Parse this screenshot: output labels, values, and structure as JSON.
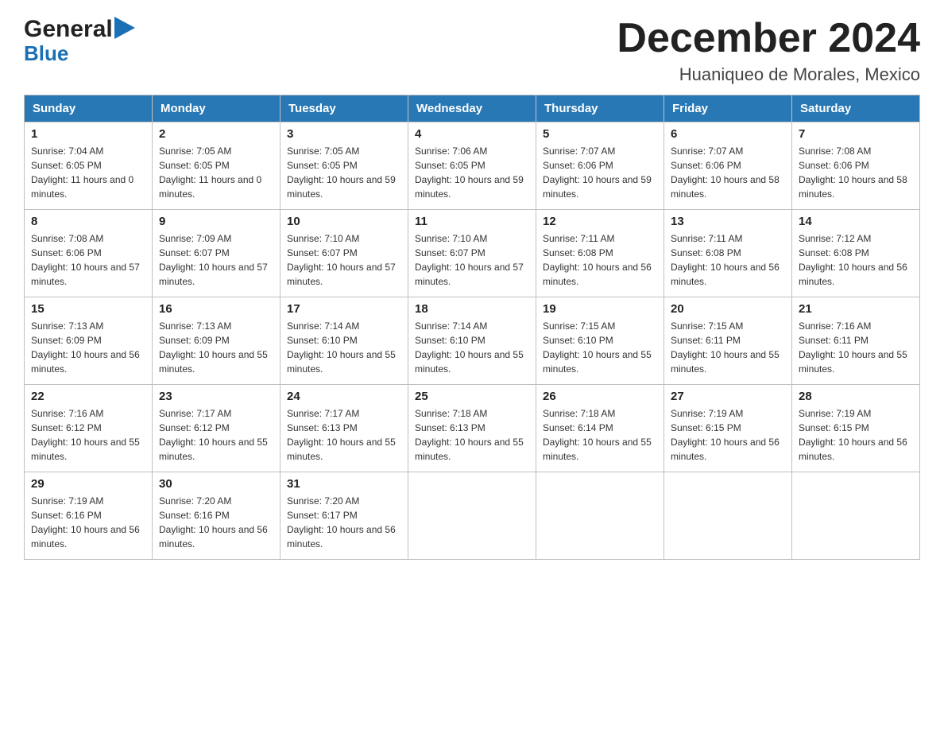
{
  "header": {
    "logo_line1": "General",
    "logo_line2": "Blue",
    "month_title": "December 2024",
    "location": "Huaniqueo de Morales, Mexico"
  },
  "days_of_week": [
    "Sunday",
    "Monday",
    "Tuesday",
    "Wednesday",
    "Thursday",
    "Friday",
    "Saturday"
  ],
  "weeks": [
    [
      {
        "day": "1",
        "sunrise": "7:04 AM",
        "sunset": "6:05 PM",
        "daylight": "11 hours and 0 minutes."
      },
      {
        "day": "2",
        "sunrise": "7:05 AM",
        "sunset": "6:05 PM",
        "daylight": "11 hours and 0 minutes."
      },
      {
        "day": "3",
        "sunrise": "7:05 AM",
        "sunset": "6:05 PM",
        "daylight": "10 hours and 59 minutes."
      },
      {
        "day": "4",
        "sunrise": "7:06 AM",
        "sunset": "6:05 PM",
        "daylight": "10 hours and 59 minutes."
      },
      {
        "day": "5",
        "sunrise": "7:07 AM",
        "sunset": "6:06 PM",
        "daylight": "10 hours and 59 minutes."
      },
      {
        "day": "6",
        "sunrise": "7:07 AM",
        "sunset": "6:06 PM",
        "daylight": "10 hours and 58 minutes."
      },
      {
        "day": "7",
        "sunrise": "7:08 AM",
        "sunset": "6:06 PM",
        "daylight": "10 hours and 58 minutes."
      }
    ],
    [
      {
        "day": "8",
        "sunrise": "7:08 AM",
        "sunset": "6:06 PM",
        "daylight": "10 hours and 57 minutes."
      },
      {
        "day": "9",
        "sunrise": "7:09 AM",
        "sunset": "6:07 PM",
        "daylight": "10 hours and 57 minutes."
      },
      {
        "day": "10",
        "sunrise": "7:10 AM",
        "sunset": "6:07 PM",
        "daylight": "10 hours and 57 minutes."
      },
      {
        "day": "11",
        "sunrise": "7:10 AM",
        "sunset": "6:07 PM",
        "daylight": "10 hours and 57 minutes."
      },
      {
        "day": "12",
        "sunrise": "7:11 AM",
        "sunset": "6:08 PM",
        "daylight": "10 hours and 56 minutes."
      },
      {
        "day": "13",
        "sunrise": "7:11 AM",
        "sunset": "6:08 PM",
        "daylight": "10 hours and 56 minutes."
      },
      {
        "day": "14",
        "sunrise": "7:12 AM",
        "sunset": "6:08 PM",
        "daylight": "10 hours and 56 minutes."
      }
    ],
    [
      {
        "day": "15",
        "sunrise": "7:13 AM",
        "sunset": "6:09 PM",
        "daylight": "10 hours and 56 minutes."
      },
      {
        "day": "16",
        "sunrise": "7:13 AM",
        "sunset": "6:09 PM",
        "daylight": "10 hours and 55 minutes."
      },
      {
        "day": "17",
        "sunrise": "7:14 AM",
        "sunset": "6:10 PM",
        "daylight": "10 hours and 55 minutes."
      },
      {
        "day": "18",
        "sunrise": "7:14 AM",
        "sunset": "6:10 PM",
        "daylight": "10 hours and 55 minutes."
      },
      {
        "day": "19",
        "sunrise": "7:15 AM",
        "sunset": "6:10 PM",
        "daylight": "10 hours and 55 minutes."
      },
      {
        "day": "20",
        "sunrise": "7:15 AM",
        "sunset": "6:11 PM",
        "daylight": "10 hours and 55 minutes."
      },
      {
        "day": "21",
        "sunrise": "7:16 AM",
        "sunset": "6:11 PM",
        "daylight": "10 hours and 55 minutes."
      }
    ],
    [
      {
        "day": "22",
        "sunrise": "7:16 AM",
        "sunset": "6:12 PM",
        "daylight": "10 hours and 55 minutes."
      },
      {
        "day": "23",
        "sunrise": "7:17 AM",
        "sunset": "6:12 PM",
        "daylight": "10 hours and 55 minutes."
      },
      {
        "day": "24",
        "sunrise": "7:17 AM",
        "sunset": "6:13 PM",
        "daylight": "10 hours and 55 minutes."
      },
      {
        "day": "25",
        "sunrise": "7:18 AM",
        "sunset": "6:13 PM",
        "daylight": "10 hours and 55 minutes."
      },
      {
        "day": "26",
        "sunrise": "7:18 AM",
        "sunset": "6:14 PM",
        "daylight": "10 hours and 55 minutes."
      },
      {
        "day": "27",
        "sunrise": "7:19 AM",
        "sunset": "6:15 PM",
        "daylight": "10 hours and 56 minutes."
      },
      {
        "day": "28",
        "sunrise": "7:19 AM",
        "sunset": "6:15 PM",
        "daylight": "10 hours and 56 minutes."
      }
    ],
    [
      {
        "day": "29",
        "sunrise": "7:19 AM",
        "sunset": "6:16 PM",
        "daylight": "10 hours and 56 minutes."
      },
      {
        "day": "30",
        "sunrise": "7:20 AM",
        "sunset": "6:16 PM",
        "daylight": "10 hours and 56 minutes."
      },
      {
        "day": "31",
        "sunrise": "7:20 AM",
        "sunset": "6:17 PM",
        "daylight": "10 hours and 56 minutes."
      },
      null,
      null,
      null,
      null
    ]
  ]
}
